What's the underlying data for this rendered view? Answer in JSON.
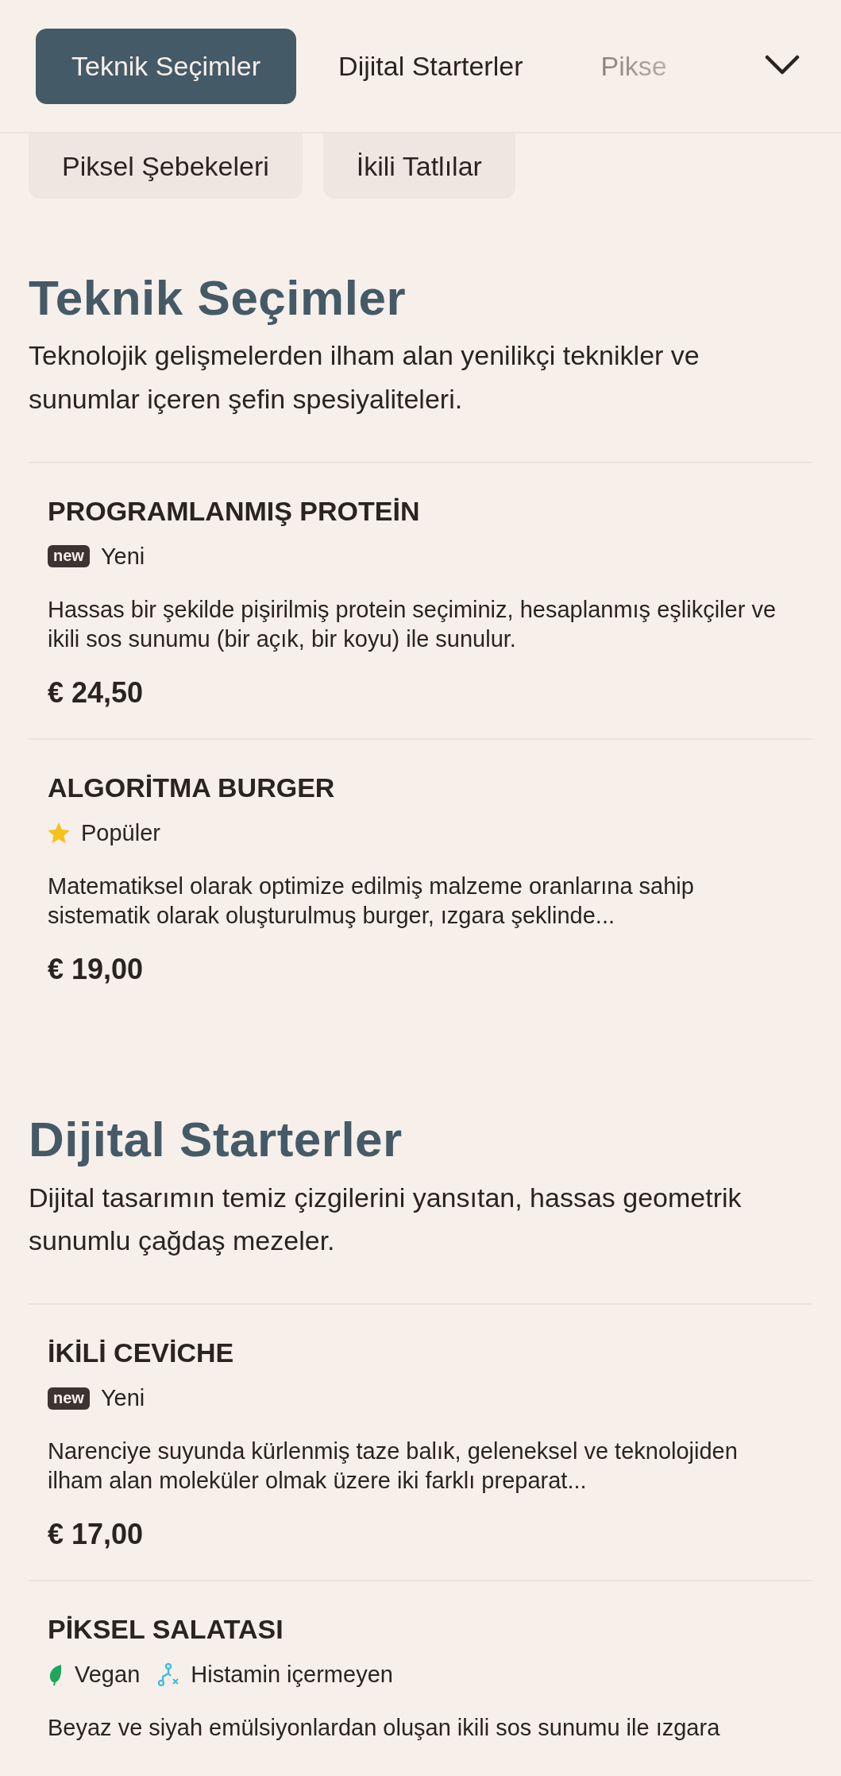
{
  "tabs": [
    {
      "label": "Teknik Seçimler",
      "selected": true
    },
    {
      "label": "Dijital Starterler",
      "selected": false
    },
    {
      "label": "Pikse",
      "selected": false
    }
  ],
  "category_chips": [
    "Piksel Şebekeleri",
    "İkili Tatlılar"
  ],
  "sections": [
    {
      "title": "Teknik Seçimler",
      "description": "Teknolojik gelişmelerden ilham alan yenilikçi teknikler ve sunumlar içeren şefin spesiyaliteleri.",
      "items": [
        {
          "name": "PROGRAMLANMIŞ PROTEİN",
          "tags": [
            {
              "kind": "new",
              "badge": "new",
              "label": "Yeni"
            }
          ],
          "description": "Hassas bir şekilde pişirilmiş protein seçiminiz, hesaplanmış eşlikçiler ve ikili sos sunumu (bir açık, bir koyu) ile sunulur.",
          "price": "€ 24,50"
        },
        {
          "name": "ALGORİTMA BURGER",
          "tags": [
            {
              "kind": "popular",
              "label": "Popüler"
            }
          ],
          "description": "Matematiksel olarak optimize edilmiş malzeme oranlarına sahip sistematik olarak oluşturulmuş burger, ızgara şeklinde...",
          "price": "€ 19,00"
        }
      ]
    },
    {
      "title": "Dijital Starterler",
      "description": "Dijital tasarımın temiz çizgilerini yansıtan, hassas geometrik sunumlu çağdaş mezeler.",
      "items": [
        {
          "name": "İKİLİ CEVİCHE",
          "tags": [
            {
              "kind": "new",
              "badge": "new",
              "label": "Yeni"
            }
          ],
          "description": "Narenciye suyunda kürlenmiş taze balık, geleneksel ve teknolojiden ilham alan moleküler olmak üzere iki farklı preparat...",
          "price": "€ 17,00"
        },
        {
          "name": "PİKSEL SALATASI",
          "tags": [
            {
              "kind": "vegan",
              "label": "Vegan"
            },
            {
              "kind": "histamine",
              "label": "Histamin içermeyen"
            }
          ],
          "description": "Beyaz ve siyah emülsiyonlardan oluşan ikili sos sunumu ile ızgara"
        }
      ]
    }
  ]
}
